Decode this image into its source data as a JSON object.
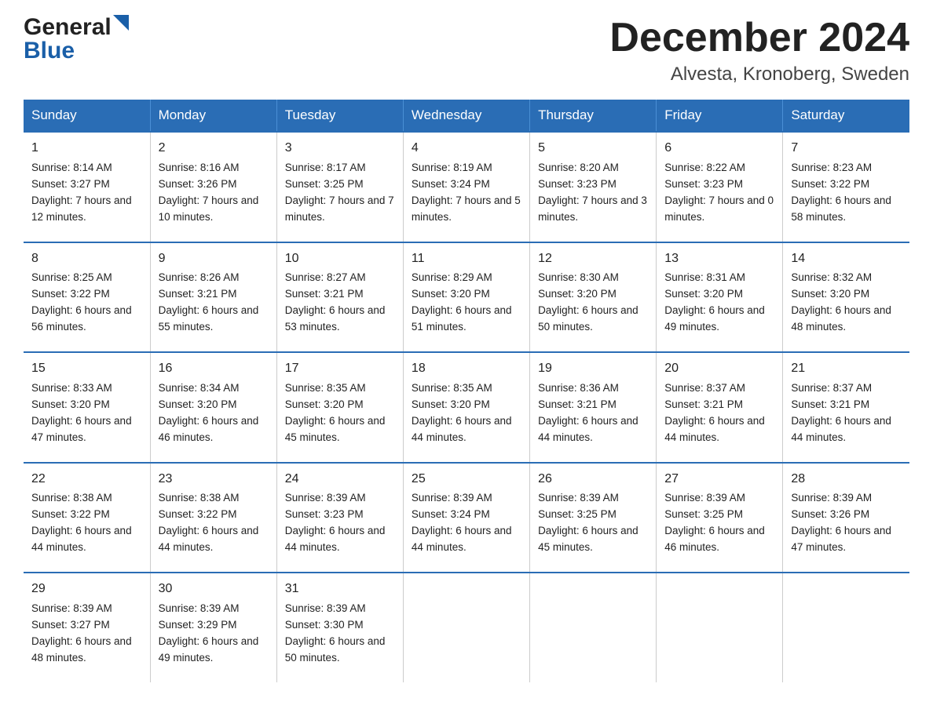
{
  "logo": {
    "general": "General",
    "blue": "Blue"
  },
  "title": "December 2024",
  "subtitle": "Alvesta, Kronoberg, Sweden",
  "days": [
    "Sunday",
    "Monday",
    "Tuesday",
    "Wednesday",
    "Thursday",
    "Friday",
    "Saturday"
  ],
  "weeks": [
    [
      {
        "num": "1",
        "sunrise": "8:14 AM",
        "sunset": "3:27 PM",
        "daylight": "7 hours and 12 minutes."
      },
      {
        "num": "2",
        "sunrise": "8:16 AM",
        "sunset": "3:26 PM",
        "daylight": "7 hours and 10 minutes."
      },
      {
        "num": "3",
        "sunrise": "8:17 AM",
        "sunset": "3:25 PM",
        "daylight": "7 hours and 7 minutes."
      },
      {
        "num": "4",
        "sunrise": "8:19 AM",
        "sunset": "3:24 PM",
        "daylight": "7 hours and 5 minutes."
      },
      {
        "num": "5",
        "sunrise": "8:20 AM",
        "sunset": "3:23 PM",
        "daylight": "7 hours and 3 minutes."
      },
      {
        "num": "6",
        "sunrise": "8:22 AM",
        "sunset": "3:23 PM",
        "daylight": "7 hours and 0 minutes."
      },
      {
        "num": "7",
        "sunrise": "8:23 AM",
        "sunset": "3:22 PM",
        "daylight": "6 hours and 58 minutes."
      }
    ],
    [
      {
        "num": "8",
        "sunrise": "8:25 AM",
        "sunset": "3:22 PM",
        "daylight": "6 hours and 56 minutes."
      },
      {
        "num": "9",
        "sunrise": "8:26 AM",
        "sunset": "3:21 PM",
        "daylight": "6 hours and 55 minutes."
      },
      {
        "num": "10",
        "sunrise": "8:27 AM",
        "sunset": "3:21 PM",
        "daylight": "6 hours and 53 minutes."
      },
      {
        "num": "11",
        "sunrise": "8:29 AM",
        "sunset": "3:20 PM",
        "daylight": "6 hours and 51 minutes."
      },
      {
        "num": "12",
        "sunrise": "8:30 AM",
        "sunset": "3:20 PM",
        "daylight": "6 hours and 50 minutes."
      },
      {
        "num": "13",
        "sunrise": "8:31 AM",
        "sunset": "3:20 PM",
        "daylight": "6 hours and 49 minutes."
      },
      {
        "num": "14",
        "sunrise": "8:32 AM",
        "sunset": "3:20 PM",
        "daylight": "6 hours and 48 minutes."
      }
    ],
    [
      {
        "num": "15",
        "sunrise": "8:33 AM",
        "sunset": "3:20 PM",
        "daylight": "6 hours and 47 minutes."
      },
      {
        "num": "16",
        "sunrise": "8:34 AM",
        "sunset": "3:20 PM",
        "daylight": "6 hours and 46 minutes."
      },
      {
        "num": "17",
        "sunrise": "8:35 AM",
        "sunset": "3:20 PM",
        "daylight": "6 hours and 45 minutes."
      },
      {
        "num": "18",
        "sunrise": "8:35 AM",
        "sunset": "3:20 PM",
        "daylight": "6 hours and 44 minutes."
      },
      {
        "num": "19",
        "sunrise": "8:36 AM",
        "sunset": "3:21 PM",
        "daylight": "6 hours and 44 minutes."
      },
      {
        "num": "20",
        "sunrise": "8:37 AM",
        "sunset": "3:21 PM",
        "daylight": "6 hours and 44 minutes."
      },
      {
        "num": "21",
        "sunrise": "8:37 AM",
        "sunset": "3:21 PM",
        "daylight": "6 hours and 44 minutes."
      }
    ],
    [
      {
        "num": "22",
        "sunrise": "8:38 AM",
        "sunset": "3:22 PM",
        "daylight": "6 hours and 44 minutes."
      },
      {
        "num": "23",
        "sunrise": "8:38 AM",
        "sunset": "3:22 PM",
        "daylight": "6 hours and 44 minutes."
      },
      {
        "num": "24",
        "sunrise": "8:39 AM",
        "sunset": "3:23 PM",
        "daylight": "6 hours and 44 minutes."
      },
      {
        "num": "25",
        "sunrise": "8:39 AM",
        "sunset": "3:24 PM",
        "daylight": "6 hours and 44 minutes."
      },
      {
        "num": "26",
        "sunrise": "8:39 AM",
        "sunset": "3:25 PM",
        "daylight": "6 hours and 45 minutes."
      },
      {
        "num": "27",
        "sunrise": "8:39 AM",
        "sunset": "3:25 PM",
        "daylight": "6 hours and 46 minutes."
      },
      {
        "num": "28",
        "sunrise": "8:39 AM",
        "sunset": "3:26 PM",
        "daylight": "6 hours and 47 minutes."
      }
    ],
    [
      {
        "num": "29",
        "sunrise": "8:39 AM",
        "sunset": "3:27 PM",
        "daylight": "6 hours and 48 minutes."
      },
      {
        "num": "30",
        "sunrise": "8:39 AM",
        "sunset": "3:29 PM",
        "daylight": "6 hours and 49 minutes."
      },
      {
        "num": "31",
        "sunrise": "8:39 AM",
        "sunset": "3:30 PM",
        "daylight": "6 hours and 50 minutes."
      },
      null,
      null,
      null,
      null
    ]
  ],
  "labels": {
    "sunrise": "Sunrise:",
    "sunset": "Sunset:",
    "daylight": "Daylight:"
  }
}
